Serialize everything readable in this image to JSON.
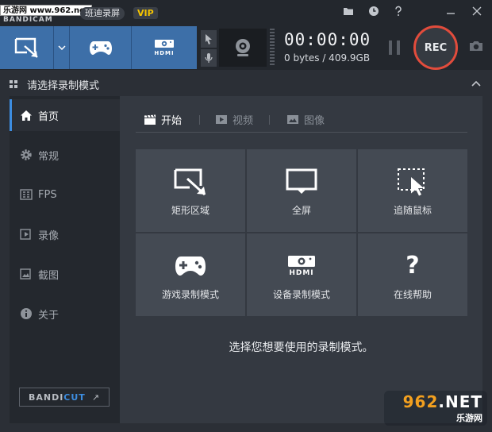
{
  "title_bar": {
    "watermark_top": "乐游网 www.962.net",
    "logo_text": "BANDICAM",
    "app_name": "班迪录屏",
    "vip_badge": "VIP",
    "buttons": [
      "folder-icon",
      "clock-icon",
      "help-icon",
      "minimize-icon",
      "close-icon"
    ]
  },
  "toolbar": {
    "hdmi_label": "HDMI",
    "timer": "00:00:00",
    "size": "0 bytes / 409.9GB",
    "rec_label": "REC"
  },
  "header": {
    "title": "请选择录制模式"
  },
  "sidebar": {
    "items": [
      {
        "label": "首页",
        "icon": "home-icon",
        "active": true
      },
      {
        "label": "常规",
        "icon": "gear-icon",
        "active": false
      },
      {
        "label": "FPS",
        "icon": "fps-icon",
        "active": false
      },
      {
        "label": "录像",
        "icon": "video-icon",
        "active": false
      },
      {
        "label": "截图",
        "icon": "screenshot-icon",
        "active": false
      },
      {
        "label": "关于",
        "icon": "info-icon",
        "active": false
      }
    ],
    "bandicut_left": "BANDI",
    "bandicut_right": "CUT",
    "bandicut_arrow": "↗"
  },
  "content": {
    "tabs": [
      {
        "label": "开始",
        "icon": "clapper-icon",
        "active": true
      },
      {
        "label": "视频",
        "icon": "play-icon",
        "active": false
      },
      {
        "label": "图像",
        "icon": "image-icon",
        "active": false
      }
    ],
    "tiles": [
      {
        "label": "矩形区域",
        "icon": "rectangle-area-icon"
      },
      {
        "label": "全屏",
        "icon": "monitor-icon"
      },
      {
        "label": "追随鼠标",
        "icon": "follow-mouse-icon"
      },
      {
        "label": "游戏录制模式",
        "icon": "gamepad-icon"
      },
      {
        "label": "设备录制模式",
        "icon": "hdmi-icon"
      },
      {
        "label": "在线帮助",
        "icon": "question-icon"
      }
    ],
    "tile_hdmi_label": "HDMI",
    "help_glyph": "?",
    "hint": "选择您想要使用的录制模式。"
  },
  "watermark_bottom": {
    "number_a": "9",
    "number_b": "6",
    "number_c": "2",
    "domain": ".NET",
    "site": "乐游网"
  },
  "colors": {
    "accent_blue": "#3d6fa8",
    "rec_red": "#e24c3c",
    "vip_gold": "#f5c400",
    "active_bar": "#3d8de0"
  }
}
